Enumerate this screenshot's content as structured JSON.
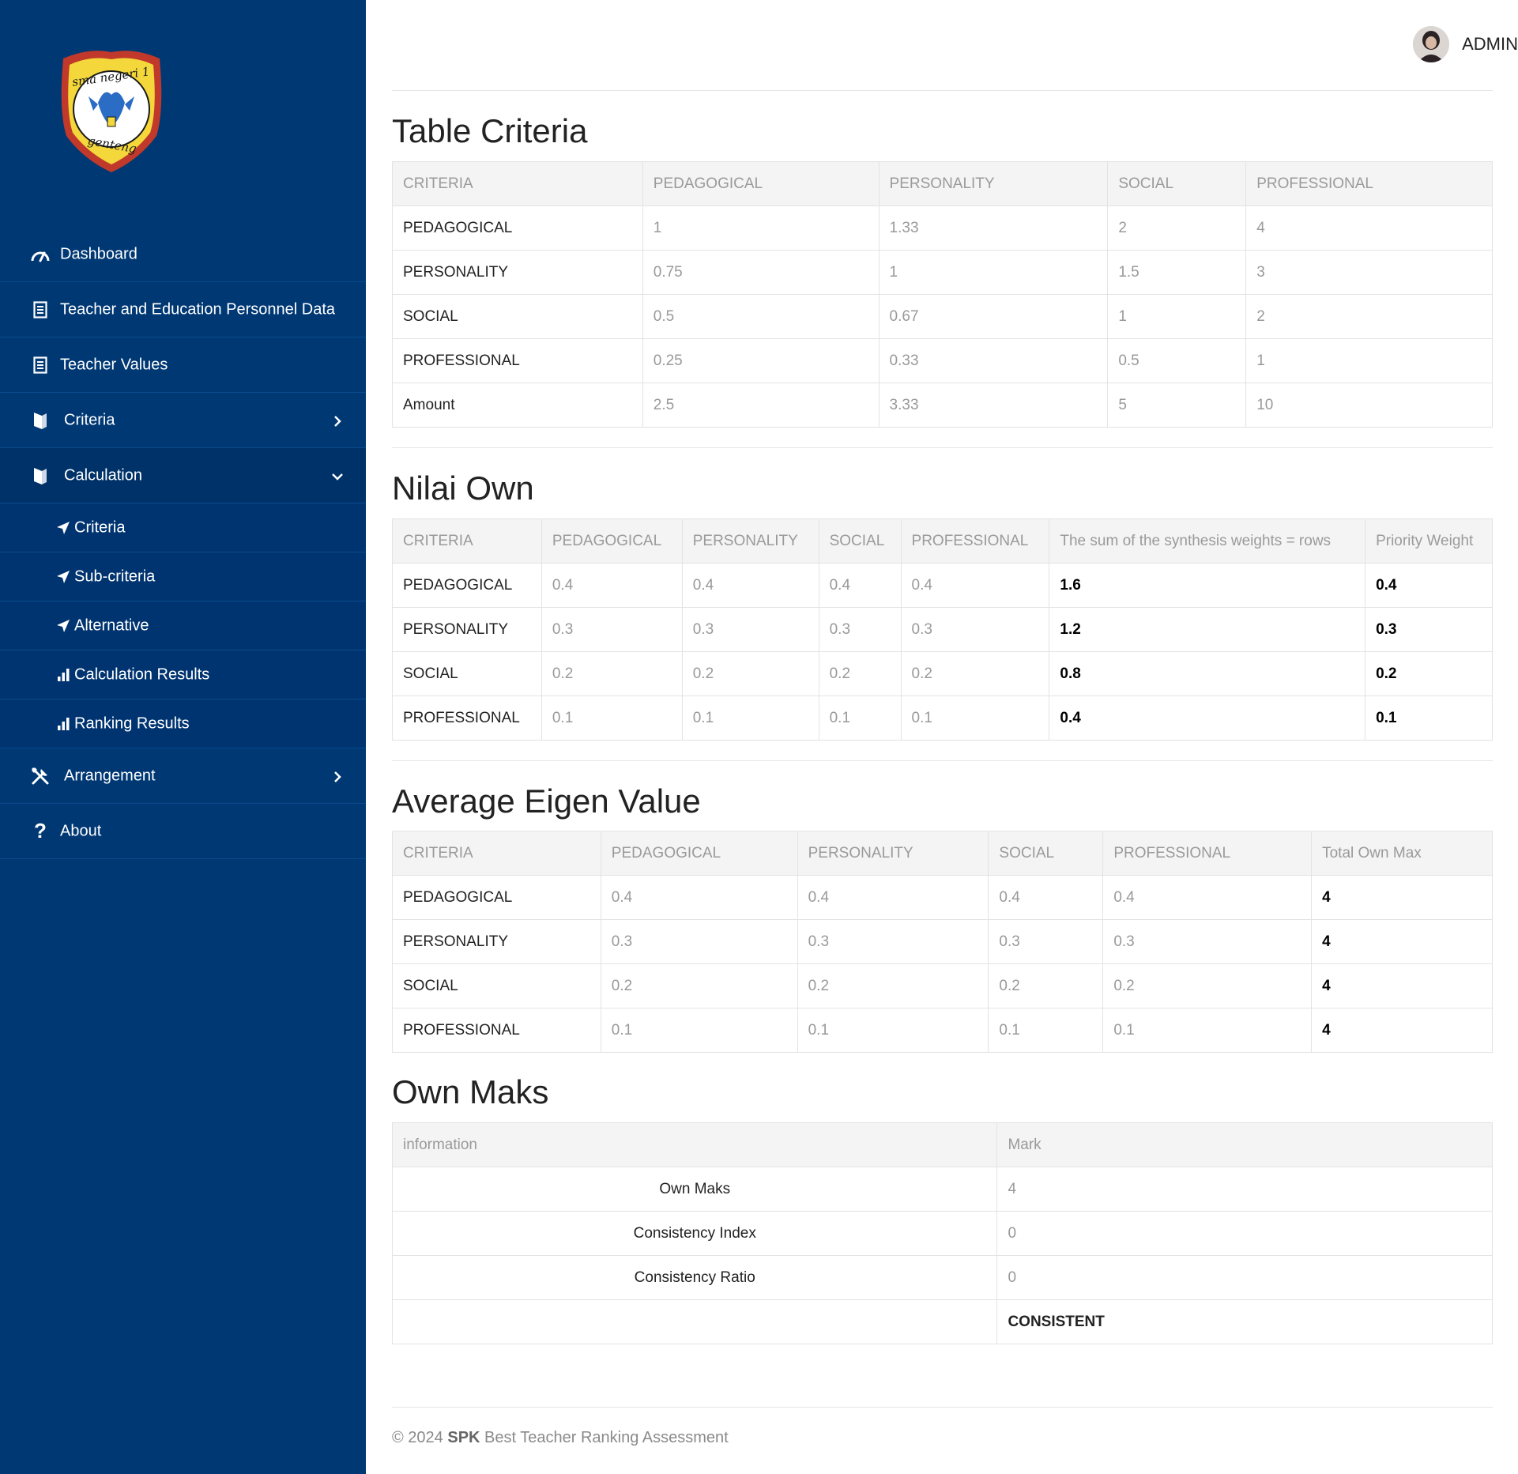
{
  "sidebar": {
    "logo": {
      "text_top": "sma negeri 1",
      "text_bottom": "genteng"
    },
    "menu": [
      {
        "label": "Dashboard",
        "icon": "gauge-icon"
      },
      {
        "label": "Teacher and Education Personnel Data",
        "icon": "document-icon"
      },
      {
        "label": "Teacher Values",
        "icon": "document-icon"
      },
      {
        "label": "Criteria",
        "icon": "book-icon",
        "chevron": "chevron-right-icon"
      },
      {
        "label": "Calculation",
        "icon": "book-icon",
        "chevron": "chevron-down-icon",
        "expanded": true
      },
      {
        "label": "Arrangement",
        "icon": "tools-icon",
        "chevron": "chevron-right-icon"
      },
      {
        "label": "About",
        "icon": "question-icon"
      }
    ],
    "submenu": [
      {
        "label": "Criteria",
        "icon": "send-icon",
        "current": true
      },
      {
        "label": "Sub-criteria",
        "icon": "send-icon"
      },
      {
        "label": "Alternative",
        "icon": "send-icon"
      },
      {
        "label": "Calculation Results",
        "icon": "bar-chart-icon"
      },
      {
        "label": "Ranking Results",
        "icon": "bar-chart-icon"
      }
    ]
  },
  "header": {
    "user": "ADMIN"
  },
  "table_criteria": {
    "title": "Table Criteria",
    "headers": [
      "CRITERIA",
      "PEDAGOGICAL",
      "PERSONALITY",
      "SOCIAL",
      "PROFESSIONAL"
    ],
    "rows": [
      [
        "PEDAGOGICAL",
        "1",
        "1.33",
        "2",
        "4"
      ],
      [
        "PERSONALITY",
        "0.75",
        "1",
        "1.5",
        "3"
      ],
      [
        "SOCIAL",
        "0.5",
        "0.67",
        "1",
        "2"
      ],
      [
        "PROFESSIONAL",
        "0.25",
        "0.33",
        "0.5",
        "1"
      ],
      [
        "Amount",
        "2.5",
        "3.33",
        "5",
        "10"
      ]
    ]
  },
  "nilai_own": {
    "title": "Nilai Own",
    "headers": [
      "CRITERIA",
      "PEDAGOGICAL",
      "PERSONALITY",
      "SOCIAL",
      "PROFESSIONAL",
      "The sum of the synthesis weights = rows",
      "Priority Weight"
    ],
    "rows": [
      [
        "PEDAGOGICAL",
        "0.4",
        "0.4",
        "0.4",
        "0.4",
        "1.6",
        "0.4"
      ],
      [
        "PERSONALITY",
        "0.3",
        "0.3",
        "0.3",
        "0.3",
        "1.2",
        "0.3"
      ],
      [
        "SOCIAL",
        "0.2",
        "0.2",
        "0.2",
        "0.2",
        "0.8",
        "0.2"
      ],
      [
        "PROFESSIONAL",
        "0.1",
        "0.1",
        "0.1",
        "0.1",
        "0.4",
        "0.1"
      ]
    ]
  },
  "average_eigen": {
    "title": "Average Eigen Value",
    "headers": [
      "CRITERIA",
      "PEDAGOGICAL",
      "PERSONALITY",
      "SOCIAL",
      "PROFESSIONAL",
      "Total Own Max"
    ],
    "rows": [
      [
        "PEDAGOGICAL",
        "0.4",
        "0.4",
        "0.4",
        "0.4",
        "4"
      ],
      [
        "PERSONALITY",
        "0.3",
        "0.3",
        "0.3",
        "0.3",
        "4"
      ],
      [
        "SOCIAL",
        "0.2",
        "0.2",
        "0.2",
        "0.2",
        "4"
      ],
      [
        "PROFESSIONAL",
        "0.1",
        "0.1",
        "0.1",
        "0.1",
        "4"
      ]
    ]
  },
  "own_maks": {
    "title": "Own Maks",
    "headers": [
      "information",
      "Mark"
    ],
    "rows": [
      [
        "Own Maks",
        "4"
      ],
      [
        "Consistency Index",
        "0"
      ],
      [
        "Consistency Ratio",
        "0"
      ],
      [
        "",
        "CONSISTENT"
      ]
    ]
  },
  "footer": {
    "prefix": "© 2024",
    "brand": "SPK",
    "text": "Best Teacher Ranking Assessment"
  },
  "colors": {
    "sidebar": "#003874",
    "header_bg": "#f4f4f4"
  }
}
